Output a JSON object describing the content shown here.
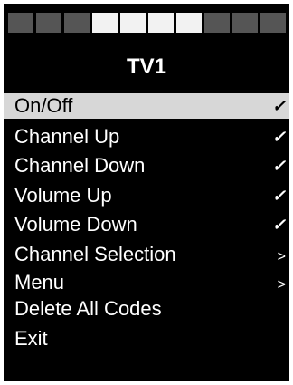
{
  "page_indicator": {
    "segments": [
      "inactive",
      "inactive",
      "inactive",
      "active",
      "active",
      "active",
      "active",
      "inactive",
      "inactive",
      "inactive"
    ]
  },
  "title": "TV1",
  "menu": {
    "items": [
      {
        "label": "On/Off",
        "mark": "✓",
        "mark_icon": "checkmark-icon"
      },
      {
        "label": "Channel Up",
        "mark": "✓",
        "mark_icon": "checkmark-icon"
      },
      {
        "label": "Channel Down",
        "mark": "✓",
        "mark_icon": "checkmark-icon"
      },
      {
        "label": "Volume Up",
        "mark": "✓",
        "mark_icon": "checkmark-icon"
      },
      {
        "label": "Volume Down",
        "mark": "✓",
        "mark_icon": "checkmark-icon"
      },
      {
        "label": "Channel Selection",
        "mark": ">",
        "mark_icon": "chevron-right-icon"
      },
      {
        "label": "Menu",
        "mark": ">",
        "mark_icon": "chevron-right-icon"
      },
      {
        "label": "Delete All Codes",
        "mark": "",
        "mark_icon": ""
      },
      {
        "label": "Exit",
        "mark": "",
        "mark_icon": ""
      }
    ],
    "selected_index": 0
  },
  "colors": {
    "background": "#000000",
    "text": "#ffffff",
    "selection_background": "#d7d7d7",
    "selection_text": "#000000",
    "segment_active": "#f2f2f2",
    "segment_inactive": "#555555"
  }
}
